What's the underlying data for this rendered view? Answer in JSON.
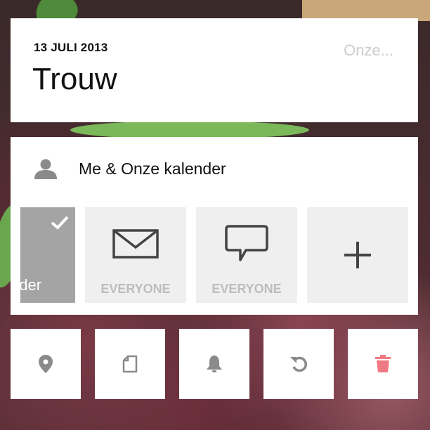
{
  "event": {
    "date": "13 JULI 2013",
    "title": "Trouw",
    "calendar_short": "Onze..."
  },
  "sharing": {
    "label": "Me & Onze kalender",
    "tiles": [
      {
        "label": "nder",
        "selected": true,
        "icon": "check-icon"
      },
      {
        "label": "EVERYONE",
        "icon": "envelope-icon"
      },
      {
        "label": "EVERYONE",
        "icon": "speech-bubble-icon"
      },
      {
        "label": "",
        "icon": "plus-icon"
      }
    ]
  },
  "actions": [
    {
      "icon": "location-pin-icon"
    },
    {
      "icon": "note-icon"
    },
    {
      "icon": "bell-icon"
    },
    {
      "icon": "repeat-icon"
    },
    {
      "icon": "trash-icon",
      "color": "#f07a83"
    }
  ],
  "colors": {
    "icon_gray": "#8a8a8a",
    "tile_bg": "#efefef",
    "tile_selected": "#a4a4a4",
    "muted_text": "#bdbdbd",
    "delete_red": "#f07a83"
  }
}
